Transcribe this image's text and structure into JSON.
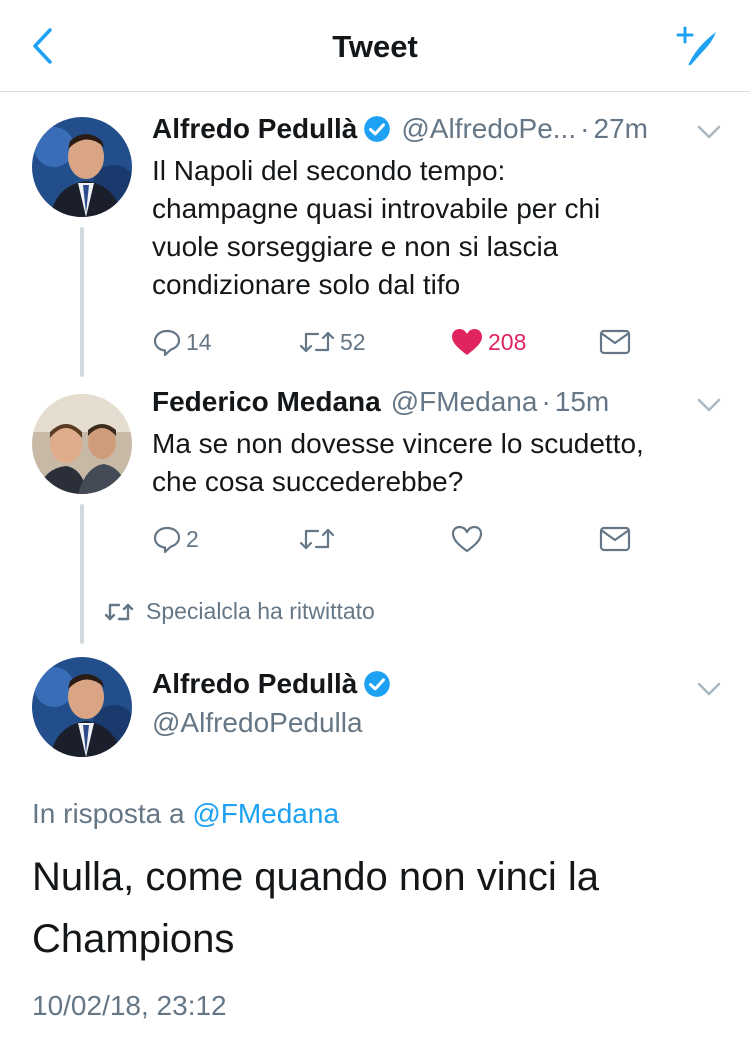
{
  "header": {
    "title": "Tweet"
  },
  "tweets": [
    {
      "name": "Alfredo Pedullà",
      "handle": "@AlfredoPe...",
      "time": "27m",
      "text_lines": [
        "Il Napoli del secondo tempo:",
        "champagne quasi introvabile per chi",
        "vuole sorseggiare e non si lascia",
        "condizionare solo dal tifo"
      ],
      "replies": "14",
      "retweets": "52",
      "likes": "208",
      "verified": true,
      "liked": true
    },
    {
      "name": "Federico Medana",
      "handle": "@FMedana",
      "time": "15m",
      "text_lines": [
        "Ma se non dovesse vincere lo scudetto,",
        "che cosa succederebbe?"
      ],
      "replies": "2",
      "retweets": "",
      "likes": "",
      "verified": false,
      "liked": false
    }
  ],
  "retweet_note": "Specialcla ha ritwittato",
  "main_tweet": {
    "name": "Alfredo Pedullà",
    "handle": "@AlfredoPedulla",
    "reply_prefix": "In risposta a",
    "reply_handle": "@FMedana",
    "text_lines": [
      "Nulla, come quando non vinci la",
      "Champions"
    ],
    "timestamp": "10/02/18, 23:12"
  },
  "icons": [
    "back-chevron-icon",
    "compose-tweet-icon",
    "verified-badge-icon",
    "reply-icon",
    "retweet-icon",
    "heart-icon",
    "direct-message-icon",
    "caret-down-icon"
  ],
  "colors": {
    "accent": "#1da1f2",
    "like": "#e0245e",
    "muted": "#657786",
    "text": "#14171a"
  }
}
